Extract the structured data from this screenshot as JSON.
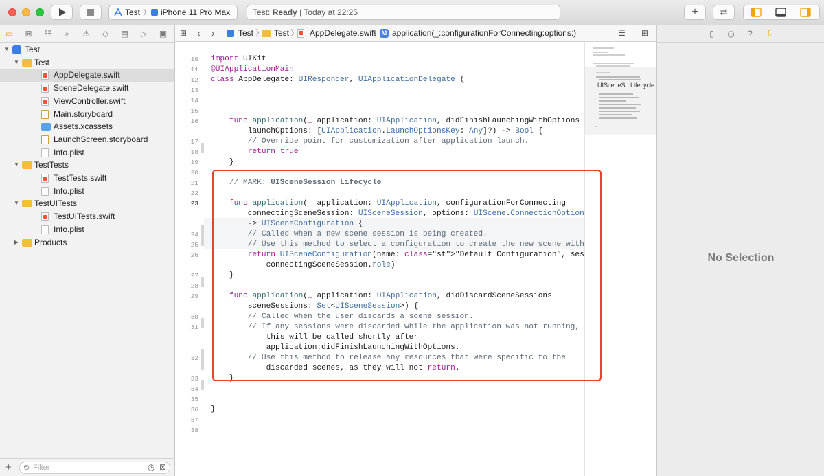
{
  "toolbar": {
    "scheme": "Test",
    "device": "iPhone 11 Pro Max",
    "status_prefix": "Test:",
    "status_state": "Ready",
    "status_time": "| Today at 22:25"
  },
  "navigator": {
    "tree": [
      {
        "label": "Test",
        "kind": "project",
        "depth": 0
      },
      {
        "label": "Test",
        "kind": "folder",
        "depth": 1
      },
      {
        "label": "AppDelegate.swift",
        "kind": "swift",
        "depth": 2,
        "selected": true
      },
      {
        "label": "SceneDelegate.swift",
        "kind": "swift",
        "depth": 2
      },
      {
        "label": "ViewController.swift",
        "kind": "swift",
        "depth": 2
      },
      {
        "label": "Main.storyboard",
        "kind": "storyboard",
        "depth": 2
      },
      {
        "label": "Assets.xcassets",
        "kind": "assets",
        "depth": 2
      },
      {
        "label": "LaunchScreen.storyboard",
        "kind": "storyboard",
        "depth": 2
      },
      {
        "label": "Info.plist",
        "kind": "plist",
        "depth": 2
      },
      {
        "label": "TestTests",
        "kind": "folder",
        "depth": 1
      },
      {
        "label": "TestTests.swift",
        "kind": "swift",
        "depth": 2
      },
      {
        "label": "Info.plist",
        "kind": "plist",
        "depth": 2
      },
      {
        "label": "TestUITests",
        "kind": "folder",
        "depth": 1
      },
      {
        "label": "TestUITests.swift",
        "kind": "swift",
        "depth": 2
      },
      {
        "label": "Info.plist",
        "kind": "plist",
        "depth": 2
      },
      {
        "label": "Products",
        "kind": "folder",
        "depth": 1,
        "collapsed": true
      }
    ],
    "filter_placeholder": "Filter"
  },
  "jumpbar": {
    "crumbs": [
      "Test",
      "Test",
      "AppDelegate.swift",
      "application(_:configurationForConnecting:options:)"
    ]
  },
  "editor": {
    "current_line": "23",
    "lines": [
      {
        "n": "10",
        "code": "import UIKit"
      },
      {
        "n": "11",
        "code": "@UIApplicationMain"
      },
      {
        "n": "12",
        "code": "class AppDelegate: UIResponder, UIApplicationDelegate {"
      },
      {
        "n": "13",
        "code": ""
      },
      {
        "n": "14",
        "code": ""
      },
      {
        "n": "15",
        "code": ""
      },
      {
        "n": "16",
        "code": "    func application(_ application: UIApplication, didFinishLaunchingWithOptions\n        launchOptions: [UIApplication.LaunchOptionsKey: Any]?) -> Bool {"
      },
      {
        "n": "17",
        "code": "        // Override point for customization after application launch."
      },
      {
        "n": "18",
        "code": "        return true"
      },
      {
        "n": "19",
        "code": "    }"
      },
      {
        "n": "20",
        "code": ""
      },
      {
        "n": "21",
        "code": "    // MARK: UISceneSession Lifecycle"
      },
      {
        "n": "22",
        "code": ""
      },
      {
        "n": "23",
        "code": "    func application(_ application: UIApplication, configurationForConnecting\n        connectingSceneSession: UISceneSession, options: UIScene.ConnectionOptions)\n        -> UISceneConfiguration {"
      },
      {
        "n": "24",
        "code": "        // Called when a new scene session is being created."
      },
      {
        "n": "25",
        "code": "        // Use this method to select a configuration to create the new scene with."
      },
      {
        "n": "26",
        "code": "        return UISceneConfiguration(name: \"Default Configuration\", sessionRole:\n            connectingSceneSession.role)"
      },
      {
        "n": "27",
        "code": "    }"
      },
      {
        "n": "28",
        "code": ""
      },
      {
        "n": "29",
        "code": "    func application(_ application: UIApplication, didDiscardSceneSessions\n        sceneSessions: Set<UISceneSession>) {"
      },
      {
        "n": "30",
        "code": "        // Called when the user discards a scene session."
      },
      {
        "n": "31",
        "code": "        // If any sessions were discarded while the application was not running,\n            this will be called shortly after\n            application:didFinishLaunchingWithOptions."
      },
      {
        "n": "32",
        "code": "        // Use this method to release any resources that were specific to the\n            discarded scenes, as they will not return."
      },
      {
        "n": "33",
        "code": "    }"
      },
      {
        "n": "34",
        "code": ""
      },
      {
        "n": "35",
        "code": ""
      },
      {
        "n": "36",
        "code": "}"
      },
      {
        "n": "37",
        "code": ""
      },
      {
        "n": "38",
        "code": ""
      }
    ]
  },
  "minimap": {
    "label": "UISceneS...Lifecycle"
  },
  "inspector": {
    "empty_text": "No Selection"
  },
  "colors": {
    "highlight": "#e8432d",
    "folder": "#f5be3a",
    "swift": "#f05138",
    "keyword": "#9b2393",
    "type": "#3f6e9e"
  }
}
